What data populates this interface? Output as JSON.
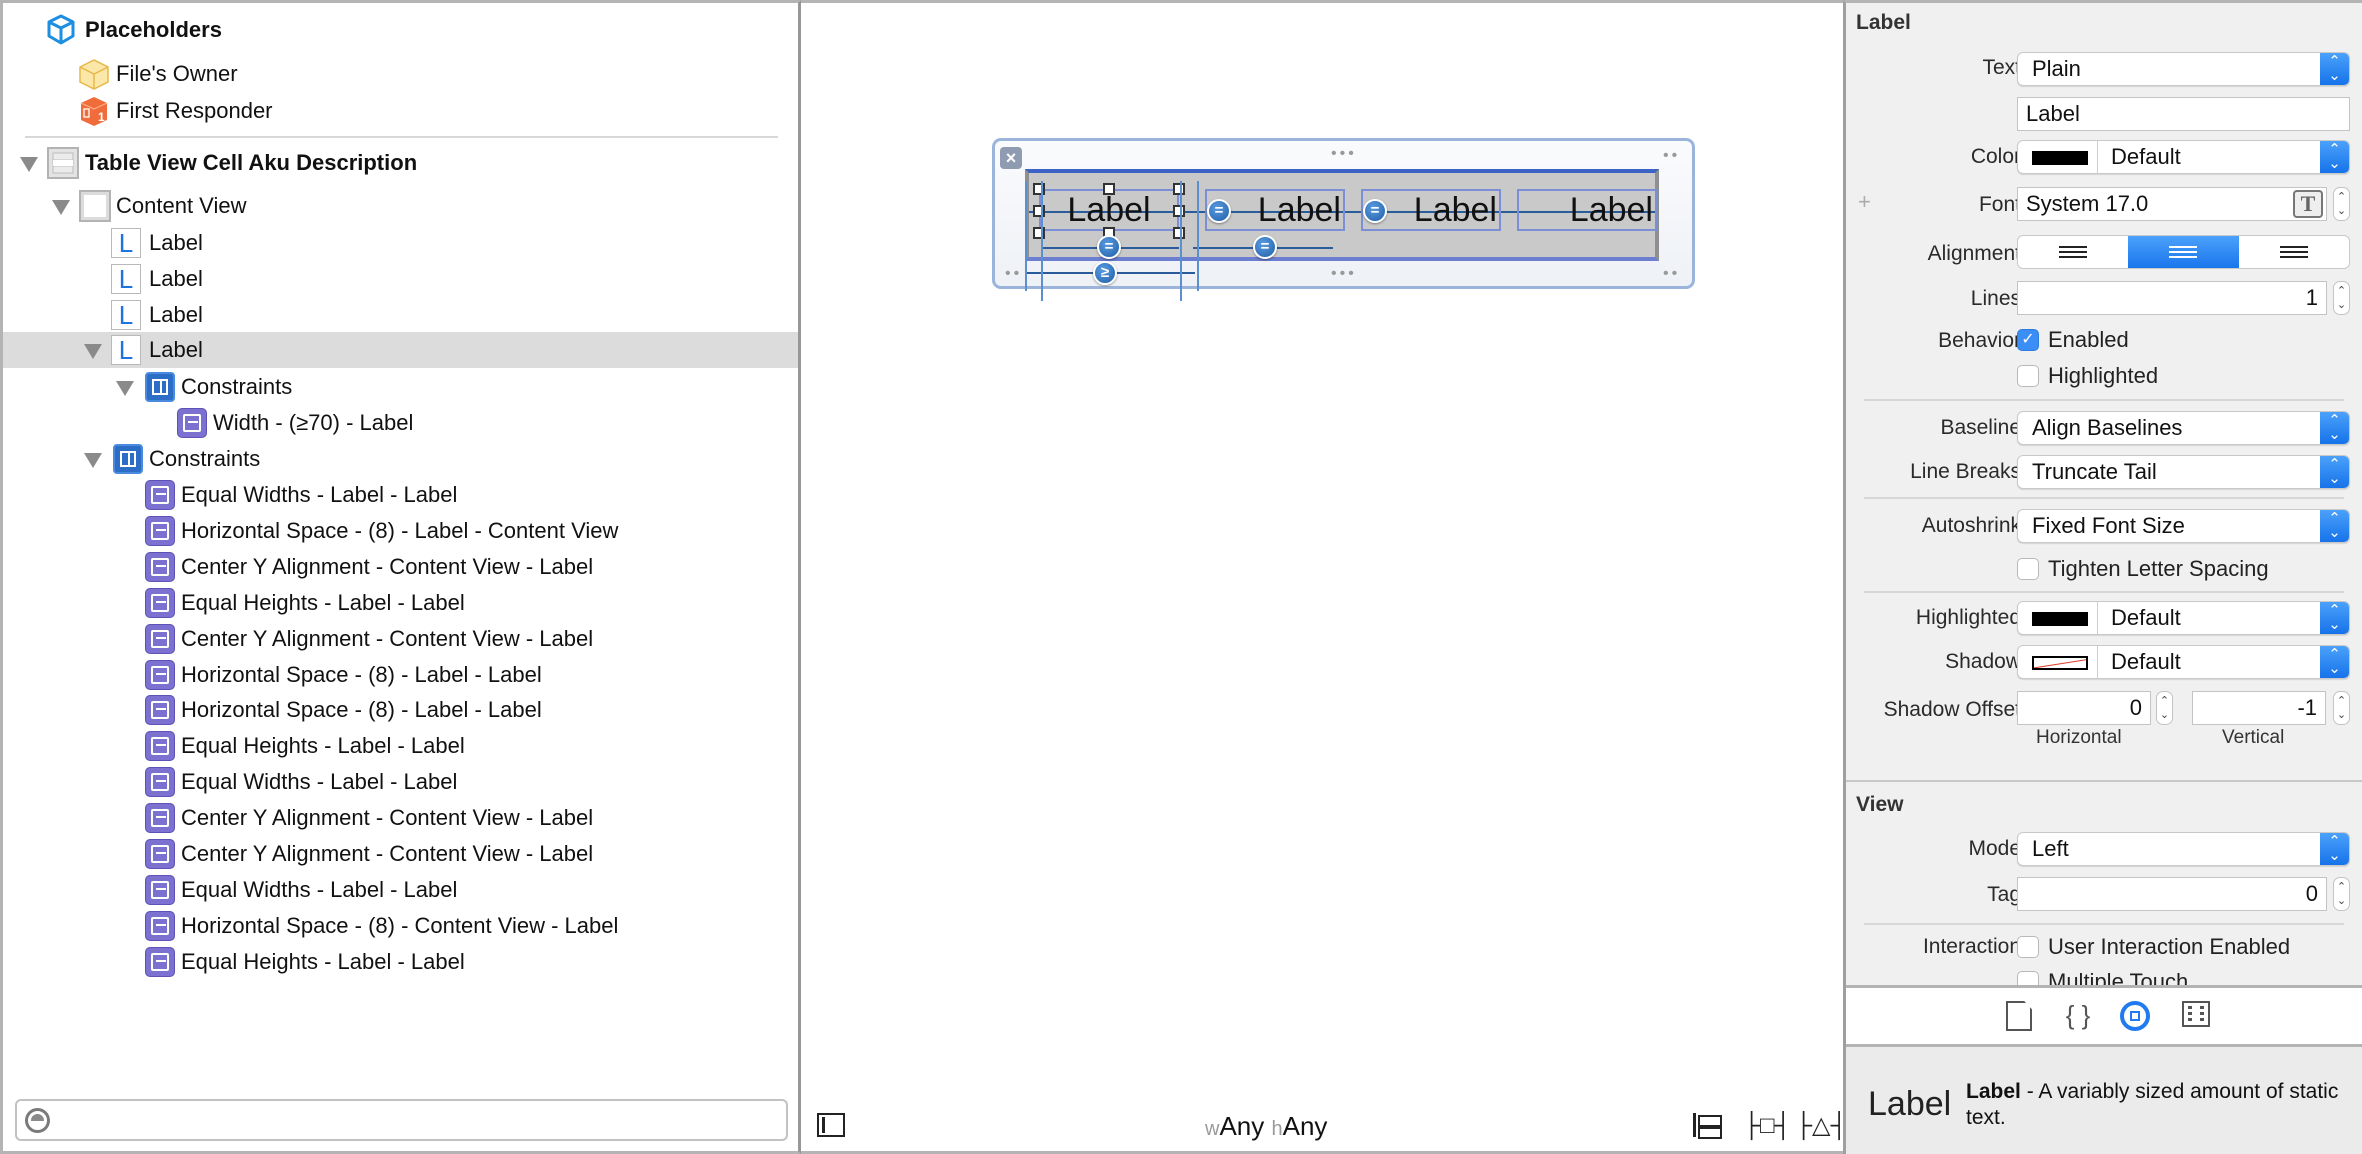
{
  "outline": {
    "placeholders_title": "Placeholders",
    "files_owner": "File's Owner",
    "first_responder": "First Responder",
    "cell_title": "Table View Cell Aku Description",
    "content_view": "Content View",
    "labels": [
      "Label",
      "Label",
      "Label",
      "Label"
    ],
    "selected_label": "Label",
    "label_constraints_title": "Constraints",
    "label_constraint_items": [
      "Width - (≥70) - Label"
    ],
    "constraints_title": "Constraints",
    "constraints": [
      {
        "type": "equal-widths",
        "text": "Equal Widths - Label - Label"
      },
      {
        "type": "horizontal-space-trailing",
        "text": "Horizontal Space - (8) - Label - Content View"
      },
      {
        "type": "center-y",
        "text": "Center Y Alignment - Content View - Label"
      },
      {
        "type": "equal-heights",
        "text": "Equal Heights - Label - Label"
      },
      {
        "type": "center-y",
        "text": "Center Y Alignment - Content View - Label"
      },
      {
        "type": "horizontal-space",
        "text": "Horizontal Space - (8) - Label - Label"
      },
      {
        "type": "horizontal-space",
        "text": "Horizontal Space - (8) - Label - Label"
      },
      {
        "type": "equal-heights",
        "text": "Equal Heights - Label - Label"
      },
      {
        "type": "equal-widths",
        "text": "Equal Widths - Label - Label"
      },
      {
        "type": "center-y",
        "text": "Center Y Alignment - Content View - Label"
      },
      {
        "type": "center-y",
        "text": "Center Y Alignment - Content View - Label"
      },
      {
        "type": "equal-widths",
        "text": "Equal Widths - Label - Label"
      },
      {
        "type": "horizontal-space-leading",
        "text": "Horizontal Space - (8) - Content View - Label"
      },
      {
        "type": "equal-heights",
        "text": "Equal Heights - Label - Label"
      }
    ],
    "filter_placeholder": ""
  },
  "canvas": {
    "cell_labels": [
      "Label",
      "Label",
      "Label",
      "Label"
    ],
    "constraint_badges": {
      "equal": "=",
      "gte": "≥"
    },
    "size_class_w_prefix": "w",
    "size_class_w": "Any",
    "size_class_h_prefix": "h",
    "size_class_h": "Any",
    "pin_glyph": "├□┤",
    "resolve_glyph": "├△┤"
  },
  "inspector": {
    "label_section": "Label",
    "text_label": "Text",
    "text_value": "Plain",
    "text_content": "Label",
    "color_label": "Color",
    "color_value": "Default",
    "color_swatch": "#000000",
    "font_label": "Font",
    "font_value": "System 17.0",
    "font_plus": "+",
    "alignment_label": "Alignment",
    "alignment_options": [
      "left",
      "center",
      "right"
    ],
    "alignment_selected": "center",
    "lines_label": "Lines",
    "lines_value": "1",
    "behavior_label": "Behavior",
    "enabled_label": "Enabled",
    "enabled_checked": true,
    "highlighted_check_label": "Highlighted",
    "highlighted_checked": false,
    "baseline_label": "Baseline",
    "baseline_value": "Align Baselines",
    "line_breaks_label": "Line Breaks",
    "line_breaks_value": "Truncate Tail",
    "autoshrink_label": "Autoshrink",
    "autoshrink_value": "Fixed Font Size",
    "tighten_label": "Tighten Letter Spacing",
    "tighten_checked": false,
    "highlighted_color_label": "Highlighted",
    "highlighted_color_value": "Default",
    "shadow_label": "Shadow",
    "shadow_value": "Default",
    "shadow_offset_label": "Shadow Offset",
    "shadow_h_value": "0",
    "shadow_v_value": "-1",
    "shadow_h_caption": "Horizontal",
    "shadow_v_caption": "Vertical",
    "view_section": "View",
    "mode_label": "Mode",
    "mode_value": "Left",
    "tag_label": "Tag",
    "tag_value": "0",
    "interaction_label": "Interaction",
    "user_interaction_label": "User Interaction Enabled",
    "user_interaction_checked": false,
    "multiple_touch_label": "Multiple Touch",
    "multiple_touch_checked": false,
    "accent_color": "#1a76ec"
  },
  "library": {
    "tabs": [
      "file-template",
      "code-snippet",
      "object-library",
      "media-library"
    ],
    "selected_tab": "object-library",
    "code_glyph": "{ }",
    "preview_text": "Label",
    "item_name": "Label",
    "item_description": " - A variably sized amount of static text."
  }
}
